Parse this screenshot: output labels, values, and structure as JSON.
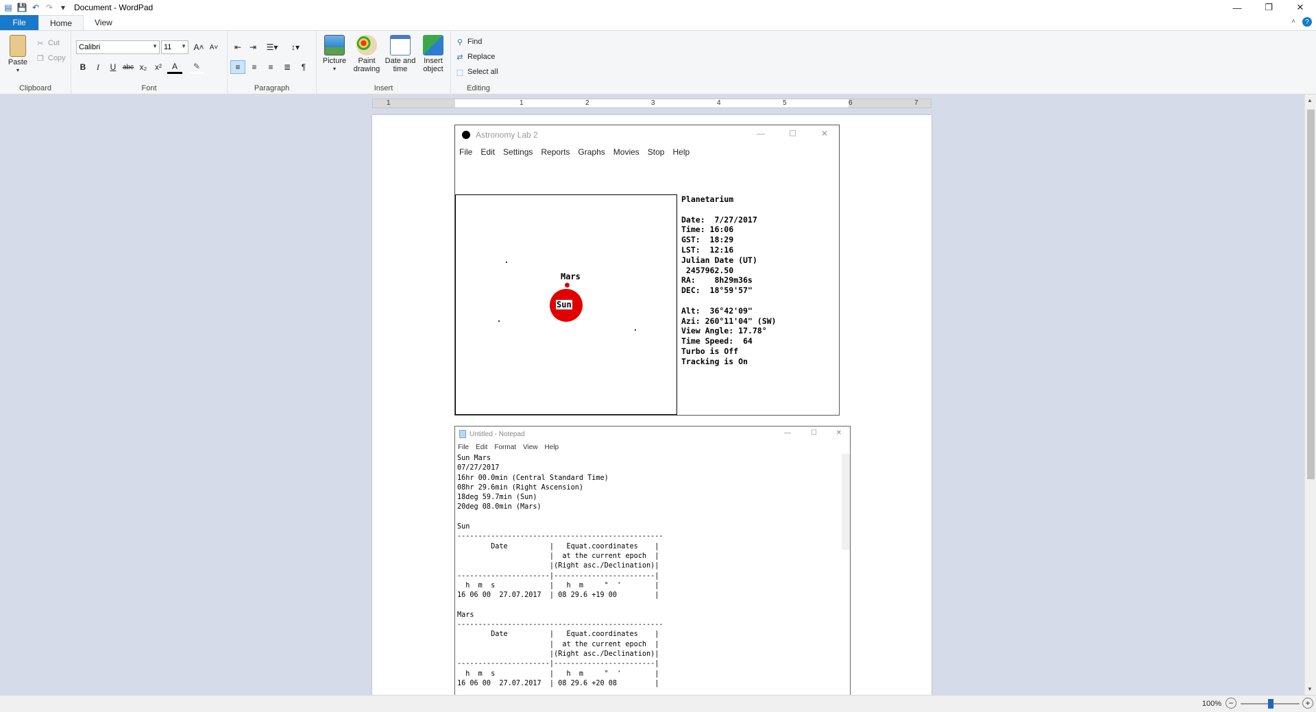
{
  "window": {
    "title": "Document - WordPad",
    "controls": {
      "minimize": "—",
      "restore": "❐",
      "close": "✕"
    }
  },
  "ribbon_tabs": [
    "File",
    "Home",
    "View"
  ],
  "clipboard": {
    "paste": "Paste",
    "cut": "Cut",
    "copy": "Copy",
    "label": "Clipboard"
  },
  "font": {
    "name": "Calibri",
    "size": "11",
    "label": "Font",
    "grow": "A˄",
    "shrink": "A˅",
    "bold": "B",
    "italic": "I",
    "underline": "U",
    "strike": "abc",
    "sub": "x₂",
    "sup": "x²",
    "color": "A",
    "highlight": "✎"
  },
  "paragraph": {
    "label": "Paragraph"
  },
  "insert": {
    "picture": "Picture",
    "paint": "Paint\ndrawing",
    "datetime": "Date and\ntime",
    "object": "Insert\nobject",
    "label": "Insert"
  },
  "editing": {
    "find": "Find",
    "replace": "Replace",
    "select_all": "Select all",
    "label": "Editing"
  },
  "ruler_numbers": [
    "1",
    "1",
    "2",
    "3",
    "4",
    "5",
    "6",
    "7"
  ],
  "astro": {
    "title": "Astronomy Lab 2",
    "menu": [
      "File",
      "Edit",
      "Settings",
      "Reports",
      "Graphs",
      "Movies",
      "Stop",
      "Help"
    ],
    "sky_labels": {
      "planet": "Mars",
      "sun": "Sun"
    },
    "info": "Planetarium\n\nDate:  7/27/2017\nTime: 16:06\nGST:  18:29\nLST:  12:16\nJulian Date (UT)\n 2457962.50\nRA:    8h29m36s\nDEC:  18°59'57\"\n\nAlt:  36°42'09\"\nAzi: 260°11'04\" (SW)\nView Angle: 17.78°\nTime Speed:  64\nTurbo is Off\nTracking is On"
  },
  "notepad": {
    "title": "Untitled - Notepad",
    "menu": [
      "File",
      "Edit",
      "Format",
      "View",
      "Help"
    ],
    "text": "Sun Mars\n07/27/2017\n16hr 00.0min (Central Standard Time)\n08hr 29.6min (Right Ascension)\n18deg 59.7min (Sun)\n20deg 08.0min (Mars)\n\nSun\n-------------------------------------------------\n        Date          |   Equat.coordinates    |\n                      |  at the current epoch  |\n                      |(Right asc./Declination)|\n----------------------|------------------------|\n  h  m  s             |   h  m     °  '        |\n16 06 00  27.07.2017  | 08 29.6 +19 00         |\n\nMars\n-------------------------------------------------\n        Date          |   Equat.coordinates    |\n                      |  at the current epoch  |\n                      |(Right asc./Declination)|\n----------------------|------------------------|\n  h  m  s             |   h  m     °  '        |\n16 06 00  27.07.2017  | 08 29.6 +20 08         |"
  },
  "status": {
    "zoom": "100%",
    "minus": "−",
    "plus": "+",
    "zoom_fraction": 0.5
  }
}
